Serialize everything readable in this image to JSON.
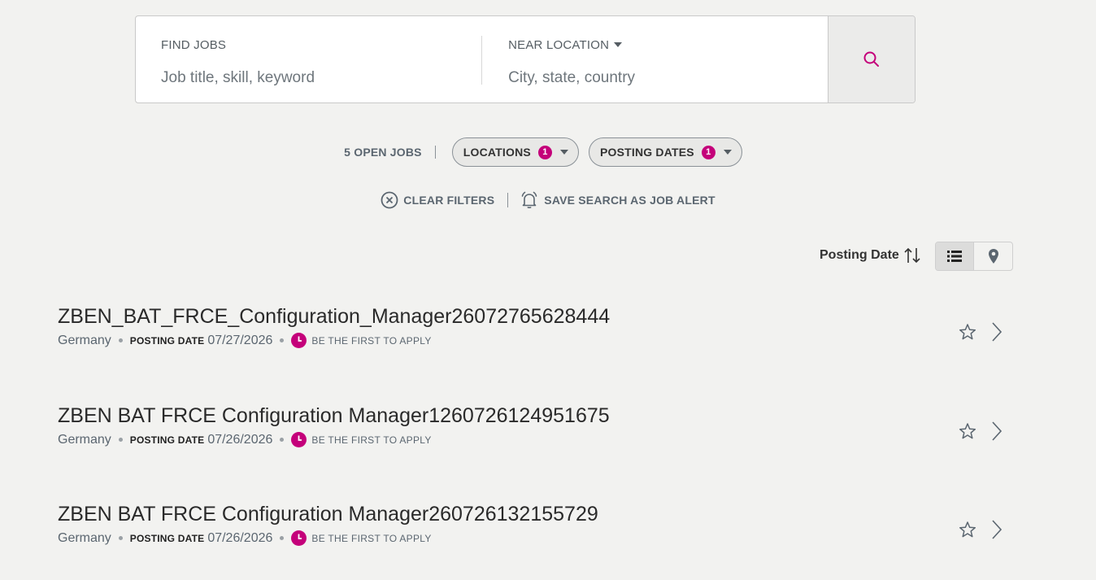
{
  "search": {
    "find_label": "FIND JOBS",
    "find_placeholder": "Job title, skill, keyword",
    "find_value": "",
    "location_label": "NEAR LOCATION",
    "location_placeholder": "City, state, country",
    "location_value": "",
    "button_icon": "search-icon"
  },
  "filters": {
    "open_jobs": "5 OPEN JOBS",
    "locations_label": "LOCATIONS",
    "locations_count": "1",
    "posting_dates_label": "POSTING DATES",
    "posting_dates_count": "1"
  },
  "actions": {
    "clear_filters": "CLEAR FILTERS",
    "save_search": "SAVE SEARCH AS JOB ALERT"
  },
  "sort": {
    "label": "Posting Date"
  },
  "jobs": [
    {
      "title": "ZBEN_BAT_FRCE_Configuration_Manager26072765628444",
      "location": "Germany",
      "posting_date_label": "POSTING DATE",
      "posting_date": "07/27/2026",
      "status": "BE THE FIRST TO APPLY"
    },
    {
      "title": "ZBEN BAT FRCE Configuration Manager1260726124951675",
      "location": "Germany",
      "posting_date_label": "POSTING DATE",
      "posting_date": "07/26/2026",
      "status": "BE THE FIRST TO APPLY"
    },
    {
      "title": "ZBEN BAT FRCE Configuration Manager260726132155729",
      "location": "Germany",
      "posting_date_label": "POSTING DATE",
      "posting_date": "07/26/2026",
      "status": "BE THE FIRST TO APPLY"
    }
  ],
  "colors": {
    "accent": "#c4007a",
    "background": "#f2f2f0",
    "muted_text": "#5b6670"
  }
}
